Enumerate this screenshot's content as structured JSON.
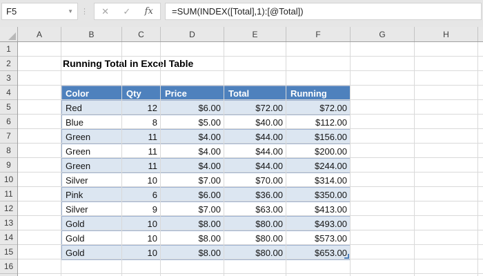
{
  "formula_bar": {
    "cell_reference": "F5",
    "name_box_arrow": "▼",
    "cancel_glyph": "✕",
    "enter_glyph": "✓",
    "fx_label": "fx",
    "separator_dots": "⋮",
    "formula": "=SUM(INDEX([Total],1):[@Total])"
  },
  "sheet": {
    "title_text": "Running Total in Excel Table",
    "column_letters": [
      "A",
      "B",
      "C",
      "D",
      "E",
      "F",
      "G",
      "H"
    ],
    "row_numbers": [
      "1",
      "2",
      "3",
      "4",
      "5",
      "6",
      "7",
      "8",
      "9",
      "10",
      "11",
      "12",
      "13",
      "14",
      "15",
      "16"
    ]
  },
  "table": {
    "headers": [
      "Color",
      "Qty",
      "Price",
      "Total",
      "Running"
    ],
    "rows": [
      [
        "Red",
        "12",
        "$6.00",
        "$72.00",
        "$72.00"
      ],
      [
        "Blue",
        "8",
        "$5.00",
        "$40.00",
        "$112.00"
      ],
      [
        "Green",
        "11",
        "$4.00",
        "$44.00",
        "$156.00"
      ],
      [
        "Green",
        "11",
        "$4.00",
        "$44.00",
        "$200.00"
      ],
      [
        "Green",
        "11",
        "$4.00",
        "$44.00",
        "$244.00"
      ],
      [
        "Silver",
        "10",
        "$7.00",
        "$70.00",
        "$314.00"
      ],
      [
        "Pink",
        "6",
        "$6.00",
        "$36.00",
        "$350.00"
      ],
      [
        "Silver",
        "9",
        "$7.00",
        "$63.00",
        "$413.00"
      ],
      [
        "Gold",
        "10",
        "$8.00",
        "$80.00",
        "$493.00"
      ],
      [
        "Gold",
        "10",
        "$8.00",
        "$80.00",
        "$573.00"
      ],
      [
        "Gold",
        "10",
        "$8.00",
        "$80.00",
        "$653.00"
      ]
    ]
  },
  "colors": {
    "header_fill": "#4E81BD",
    "band_fill": "#DCE6F1",
    "table_border": "#9EB2D1",
    "gridline": "#D9D9D9",
    "chrome": "#E6E6E6"
  }
}
